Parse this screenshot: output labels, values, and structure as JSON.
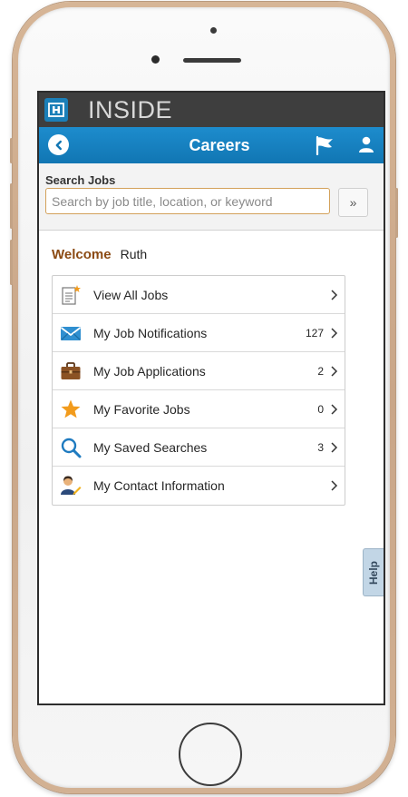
{
  "header": {
    "app_name": "INSIDE",
    "page_title": "Careers"
  },
  "search": {
    "label": "Search Jobs",
    "placeholder": "Search by job title, location, or keyword",
    "value": "",
    "go_label": "»"
  },
  "welcome": {
    "label": "Welcome",
    "name": "Ruth"
  },
  "menu": {
    "items": [
      {
        "label": "View All Jobs",
        "count": "",
        "icon": "document-star-icon"
      },
      {
        "label": "My Job Notifications",
        "count": "127",
        "icon": "envelope-icon"
      },
      {
        "label": "My Job Applications",
        "count": "2",
        "icon": "briefcase-icon"
      },
      {
        "label": "My Favorite Jobs",
        "count": "0",
        "icon": "star-icon"
      },
      {
        "label": "My Saved Searches",
        "count": "3",
        "icon": "magnifier-icon"
      },
      {
        "label": "My Contact Information",
        "count": "",
        "icon": "contact-person-icon"
      }
    ]
  },
  "help": {
    "label": "Help"
  },
  "colors": {
    "header_dark": "#3e3e3e",
    "accent_blue": "#1176b3",
    "welcome_brown": "#8b4a13",
    "input_border": "#d3a15a"
  }
}
